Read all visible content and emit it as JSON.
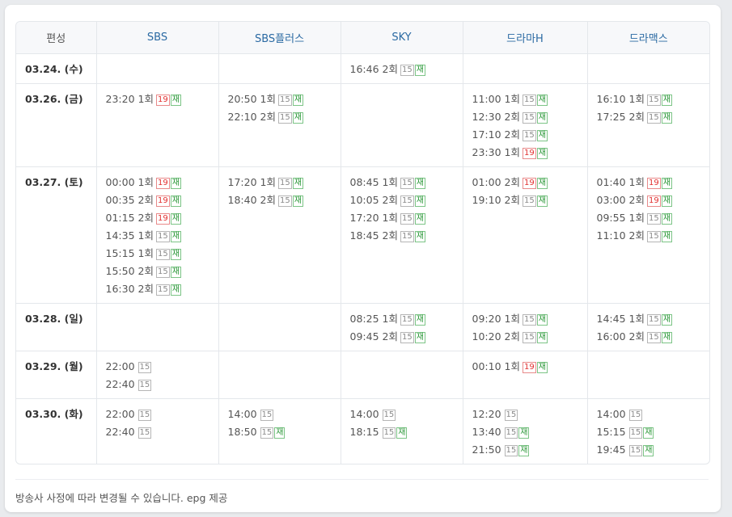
{
  "headers": [
    "편성",
    "SBS",
    "SBS플러스",
    "SKY",
    "드라마H",
    "드라맥스"
  ],
  "rows": [
    {
      "date": "03.24. (수)",
      "cells": [
        [],
        [],
        [
          {
            "time": "16:46",
            "ep": "2회",
            "rating": "15",
            "rerun": true
          }
        ],
        [],
        []
      ]
    },
    {
      "date": "03.26. (금)",
      "cells": [
        [
          {
            "time": "23:20",
            "ep": "1회",
            "rating": "19",
            "rerun": true
          }
        ],
        [
          {
            "time": "20:50",
            "ep": "1회",
            "rating": "15",
            "rerun": true
          },
          {
            "time": "22:10",
            "ep": "2회",
            "rating": "15",
            "rerun": true
          }
        ],
        [],
        [
          {
            "time": "11:00",
            "ep": "1회",
            "rating": "15",
            "rerun": true
          },
          {
            "time": "12:30",
            "ep": "2회",
            "rating": "15",
            "rerun": true
          },
          {
            "time": "17:10",
            "ep": "2회",
            "rating": "15",
            "rerun": true
          },
          {
            "time": "23:30",
            "ep": "1회",
            "rating": "19",
            "rerun": true
          }
        ],
        [
          {
            "time": "16:10",
            "ep": "1회",
            "rating": "15",
            "rerun": true
          },
          {
            "time": "17:25",
            "ep": "2회",
            "rating": "15",
            "rerun": true
          }
        ]
      ]
    },
    {
      "date": "03.27. (토)",
      "cells": [
        [
          {
            "time": "00:00",
            "ep": "1회",
            "rating": "19",
            "rerun": true
          },
          {
            "time": "00:35",
            "ep": "2회",
            "rating": "19",
            "rerun": true
          },
          {
            "time": "01:15",
            "ep": "2회",
            "rating": "19",
            "rerun": true
          },
          {
            "time": "14:35",
            "ep": "1회",
            "rating": "15",
            "rerun": true
          },
          {
            "time": "15:15",
            "ep": "1회",
            "rating": "15",
            "rerun": true
          },
          {
            "time": "15:50",
            "ep": "2회",
            "rating": "15",
            "rerun": true
          },
          {
            "time": "16:30",
            "ep": "2회",
            "rating": "15",
            "rerun": true
          }
        ],
        [
          {
            "time": "17:20",
            "ep": "1회",
            "rating": "15",
            "rerun": true
          },
          {
            "time": "18:40",
            "ep": "2회",
            "rating": "15",
            "rerun": true
          }
        ],
        [
          {
            "time": "08:45",
            "ep": "1회",
            "rating": "15",
            "rerun": true
          },
          {
            "time": "10:05",
            "ep": "2회",
            "rating": "15",
            "rerun": true
          },
          {
            "time": "17:20",
            "ep": "1회",
            "rating": "15",
            "rerun": true
          },
          {
            "time": "18:45",
            "ep": "2회",
            "rating": "15",
            "rerun": true
          }
        ],
        [
          {
            "time": "01:00",
            "ep": "2회",
            "rating": "19",
            "rerun": true
          },
          {
            "time": "19:10",
            "ep": "2회",
            "rating": "15",
            "rerun": true
          }
        ],
        [
          {
            "time": "01:40",
            "ep": "1회",
            "rating": "19",
            "rerun": true
          },
          {
            "time": "03:00",
            "ep": "2회",
            "rating": "19",
            "rerun": true
          },
          {
            "time": "09:55",
            "ep": "1회",
            "rating": "15",
            "rerun": true
          },
          {
            "time": "11:10",
            "ep": "2회",
            "rating": "15",
            "rerun": true
          }
        ]
      ]
    },
    {
      "date": "03.28. (일)",
      "cells": [
        [],
        [],
        [
          {
            "time": "08:25",
            "ep": "1회",
            "rating": "15",
            "rerun": true
          },
          {
            "time": "09:45",
            "ep": "2회",
            "rating": "15",
            "rerun": true
          }
        ],
        [
          {
            "time": "09:20",
            "ep": "1회",
            "rating": "15",
            "rerun": true
          },
          {
            "time": "10:20",
            "ep": "2회",
            "rating": "15",
            "rerun": true
          }
        ],
        [
          {
            "time": "14:45",
            "ep": "1회",
            "rating": "15",
            "rerun": true
          },
          {
            "time": "16:00",
            "ep": "2회",
            "rating": "15",
            "rerun": true
          }
        ]
      ]
    },
    {
      "date": "03.29. (월)",
      "cells": [
        [
          {
            "time": "22:00",
            "ep": "",
            "rating": "15",
            "rerun": false
          },
          {
            "time": "22:40",
            "ep": "",
            "rating": "15",
            "rerun": false
          }
        ],
        [],
        [],
        [
          {
            "time": "00:10",
            "ep": "1회",
            "rating": "19",
            "rerun": true
          }
        ],
        []
      ]
    },
    {
      "date": "03.30. (화)",
      "cells": [
        [
          {
            "time": "22:00",
            "ep": "",
            "rating": "15",
            "rerun": false
          },
          {
            "time": "22:40",
            "ep": "",
            "rating": "15",
            "rerun": false
          }
        ],
        [
          {
            "time": "14:00",
            "ep": "",
            "rating": "15",
            "rerun": false
          },
          {
            "time": "18:50",
            "ep": "",
            "rating": "15",
            "rerun": true
          }
        ],
        [
          {
            "time": "14:00",
            "ep": "",
            "rating": "15",
            "rerun": false
          },
          {
            "time": "18:15",
            "ep": "",
            "rating": "15",
            "rerun": true
          }
        ],
        [
          {
            "time": "12:20",
            "ep": "",
            "rating": "15",
            "rerun": false
          },
          {
            "time": "13:40",
            "ep": "",
            "rating": "15",
            "rerun": true
          },
          {
            "time": "21:50",
            "ep": "",
            "rating": "15",
            "rerun": true
          }
        ],
        [
          {
            "time": "14:00",
            "ep": "",
            "rating": "15",
            "rerun": false
          },
          {
            "time": "15:15",
            "ep": "",
            "rating": "15",
            "rerun": true
          },
          {
            "time": "19:45",
            "ep": "",
            "rating": "15",
            "rerun": true
          }
        ]
      ]
    }
  ],
  "rerun_label": "재",
  "footer": "방송사 사정에 따라 변경될 수 있습니다. epg 제공",
  "colors": {
    "header_text": "#2b6aa3",
    "rating19": "#e23030",
    "rerun": "#2f9a3c",
    "rating15": "#8a8a8a"
  }
}
